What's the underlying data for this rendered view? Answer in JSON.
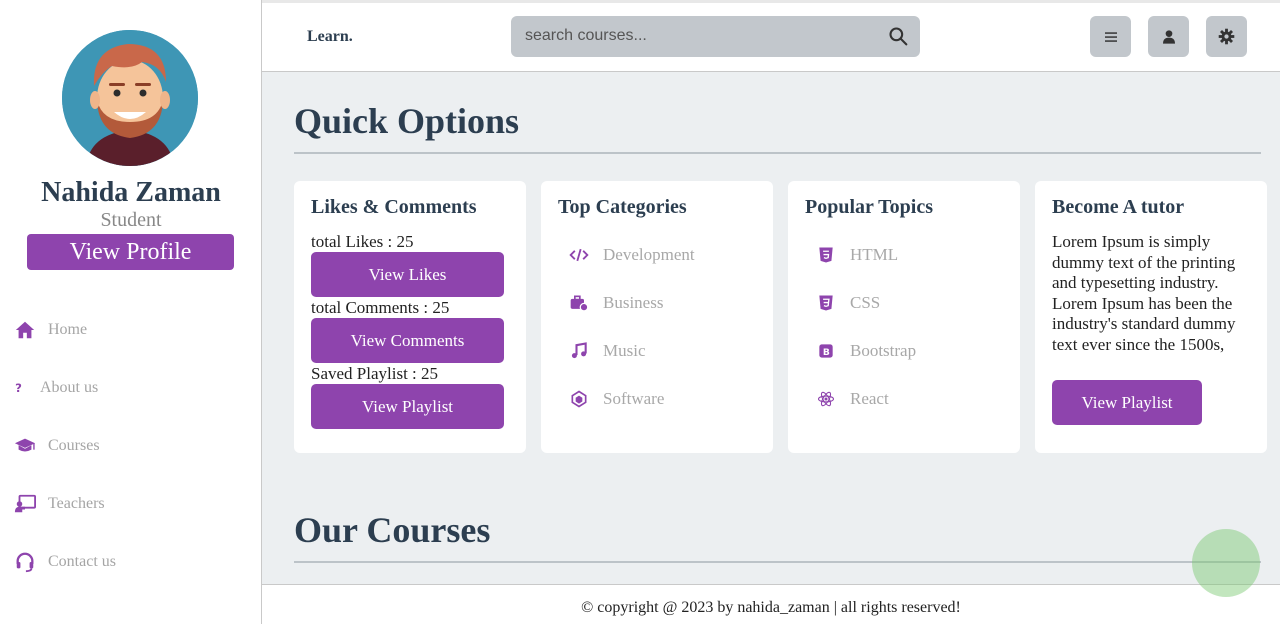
{
  "header": {
    "logo": "Learn.",
    "search_placeholder": "search courses...",
    "buttons": [
      "menu-icon",
      "user-icon",
      "gear-icon"
    ]
  },
  "profile": {
    "name": "Nahida Zaman",
    "role": "Student",
    "button": "View Profile"
  },
  "nav": [
    {
      "label": "Home",
      "icon": "home-icon"
    },
    {
      "label": "About us",
      "icon": "question-icon"
    },
    {
      "label": "Courses",
      "icon": "graduation-cap-icon"
    },
    {
      "label": "Teachers",
      "icon": "chalkboard-teacher-icon"
    },
    {
      "label": "Contact us",
      "icon": "headset-icon"
    }
  ],
  "quick_options": {
    "title": "Quick Options",
    "likes_card": {
      "title": "Likes & Comments",
      "likes_text": "total Likes : 25",
      "likes_button": "View Likes",
      "comments_text": "total Comments : 25",
      "comments_button": "View Comments",
      "playlist_text": "Saved Playlist : 25",
      "playlist_button": "View Playlist"
    },
    "categories_card": {
      "title": "Top Categories",
      "items": [
        "Development",
        "Business",
        "Music",
        "Software"
      ]
    },
    "topics_card": {
      "title": "Popular Topics",
      "items": [
        "HTML",
        "CSS",
        "Bootstrap",
        "React"
      ]
    },
    "tutor_card": {
      "title": "Become A tutor",
      "text": "Lorem Ipsum is simply dummy text of the printing and typesetting industry. Lorem Ipsum has been the industry's standard dummy text ever since the 1500s,",
      "button": "View Playlist"
    }
  },
  "courses_title": "Our Courses",
  "footer": "© copyright @ 2023 by nahida_zaman | all rights reserved!",
  "colors": {
    "accent": "#8e44ad",
    "heading": "#2c3e50",
    "background": "#eceff1"
  }
}
